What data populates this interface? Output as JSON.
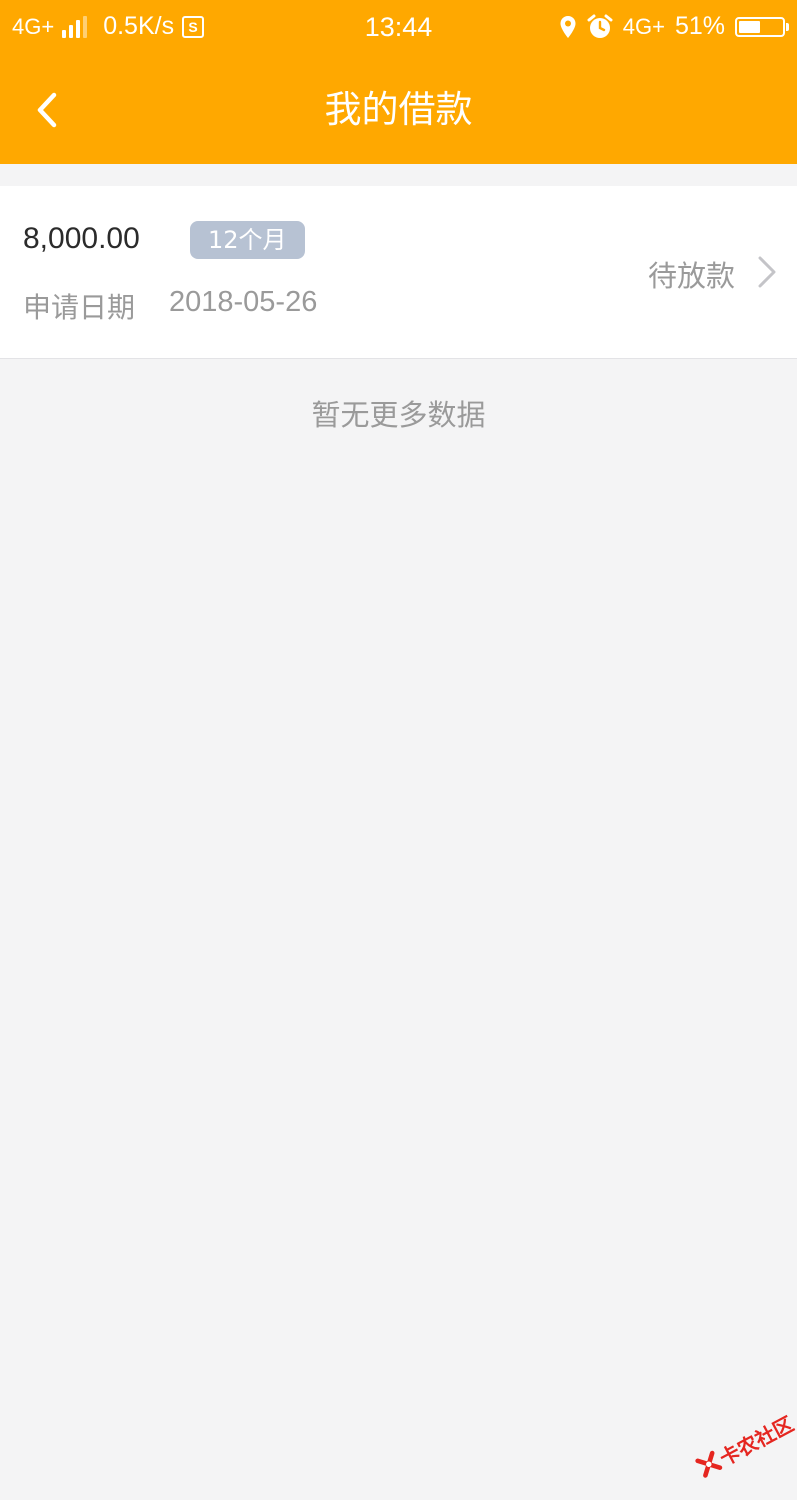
{
  "status_bar": {
    "network_left": "4G+",
    "speed": "0.5K/s",
    "s_badge": "S",
    "time": "13:44",
    "network_right": "4G+",
    "battery_text": "51%",
    "battery_level": 0.51,
    "icons": [
      "signal-icon",
      "s-box-icon",
      "location-icon",
      "alarm-icon",
      "battery-icon"
    ]
  },
  "nav": {
    "title": "我的借款",
    "back_icon": "chevron-left-icon"
  },
  "loan": {
    "amount": "8,000.00",
    "term": "12个月",
    "apply_label": "申请日期",
    "apply_date": "2018-05-26",
    "status": "待放款",
    "arrow_icon": "chevron-right-icon"
  },
  "list": {
    "no_more": "暂无更多数据"
  },
  "watermark": {
    "text": "卡农社区"
  },
  "colors": {
    "primary": "#ffa800",
    "badge": "#b7c2d3",
    "background": "#f4f4f5",
    "muted_text": "#9a9a9a",
    "watermark": "#e52620"
  }
}
